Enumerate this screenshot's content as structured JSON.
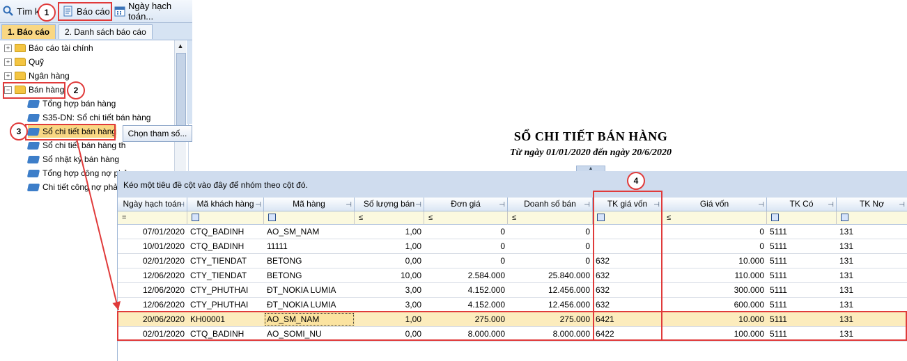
{
  "toolbar": {
    "search": "Tìm kiế",
    "report": "Báo cáo",
    "posting_date": "Ngày hạch toán..."
  },
  "tabs": [
    {
      "label": "1. Báo cáo"
    },
    {
      "label": "2. Danh sách báo cáo"
    }
  ],
  "tree": {
    "folders": [
      {
        "label": "Báo cáo tài chính",
        "expander": "+"
      },
      {
        "label": "Quỹ",
        "expander": "+"
      },
      {
        "label": "Ngân hàng",
        "expander": "+"
      },
      {
        "label": "Bán hàng",
        "expander": "−"
      }
    ],
    "reports": [
      {
        "label": "Tổng hợp bán hàng"
      },
      {
        "label": "S35-DN: Sổ chi tiết bán hàng"
      },
      {
        "label": "Sổ chi tiết bán hàng"
      },
      {
        "label": "Sổ chi tiết bán hàng th"
      },
      {
        "label": "Sổ nhật ký bán hàng"
      },
      {
        "label": "Tổng hợp công nợ phả"
      },
      {
        "label": "Chi tiết công nợ phải t"
      }
    ]
  },
  "choose_params_button": "Chọn tham số...",
  "marks": [
    "1",
    "2",
    "3",
    "4"
  ],
  "report": {
    "title": "SỔ CHI TIẾT BÁN HÀNG",
    "subtitle": "Từ ngày 01/01/2020 đến ngày 20/6/2020"
  },
  "grid": {
    "group_hint": "Kéo một tiêu đề cột vào đây để nhóm theo cột đó.",
    "columns": [
      "Ngày hạch toán",
      "Mã khách hàng",
      "Mã hàng",
      "Số lượng bán",
      "Đơn giá",
      "Doanh số bán",
      "TK giá vốn",
      "Giá vốn",
      "TK Có",
      "TK Nợ"
    ],
    "filters": [
      "=",
      "",
      "",
      "≤",
      "≤",
      "≤",
      "",
      "≤",
      "",
      ""
    ],
    "rows": [
      [
        "07/01/2020",
        "CTQ_BADINH",
        "AO_SM_NAM",
        "1,00",
        "0",
        "0",
        "",
        "0",
        "5111",
        "131"
      ],
      [
        "10/01/2020",
        "CTQ_BADINH",
        "11111",
        "1,00",
        "0",
        "0",
        "",
        "0",
        "5111",
        "131"
      ],
      [
        "02/01/2020",
        "CTY_TIENDAT",
        "BETONG",
        "0,00",
        "0",
        "0",
        "632",
        "10.000",
        "5111",
        "131"
      ],
      [
        "12/06/2020",
        "CTY_TIENDAT",
        "BETONG",
        "10,00",
        "2.584.000",
        "25.840.000",
        "632",
        "110.000",
        "5111",
        "131"
      ],
      [
        "12/06/2020",
        "CTY_PHUTHAI",
        "ĐT_NOKIA LUMIA",
        "3,00",
        "4.152.000",
        "12.456.000",
        "632",
        "300.000",
        "5111",
        "131"
      ],
      [
        "12/06/2020",
        "CTY_PHUTHAI",
        "ĐT_NOKIA LUMIA",
        "3,00",
        "4.152.000",
        "12.456.000",
        "632",
        "600.000",
        "5111",
        "131"
      ],
      [
        "20/06/2020",
        "KH00001",
        "AO_SM_NAM",
        "1,00",
        "275.000",
        "275.000",
        "6421",
        "10.000",
        "5111",
        "131"
      ],
      [
        "02/01/2020",
        "CTQ_BADINH",
        "AO_SOMI_NU",
        "0,00",
        "8.000.000",
        "8.000.000",
        "6422",
        "100.000",
        "5111",
        "131"
      ]
    ]
  },
  "colors": {
    "annotation_red": "#e03a3a",
    "selected_row": "#fcecbd",
    "filter_row": "#fbf9df"
  }
}
